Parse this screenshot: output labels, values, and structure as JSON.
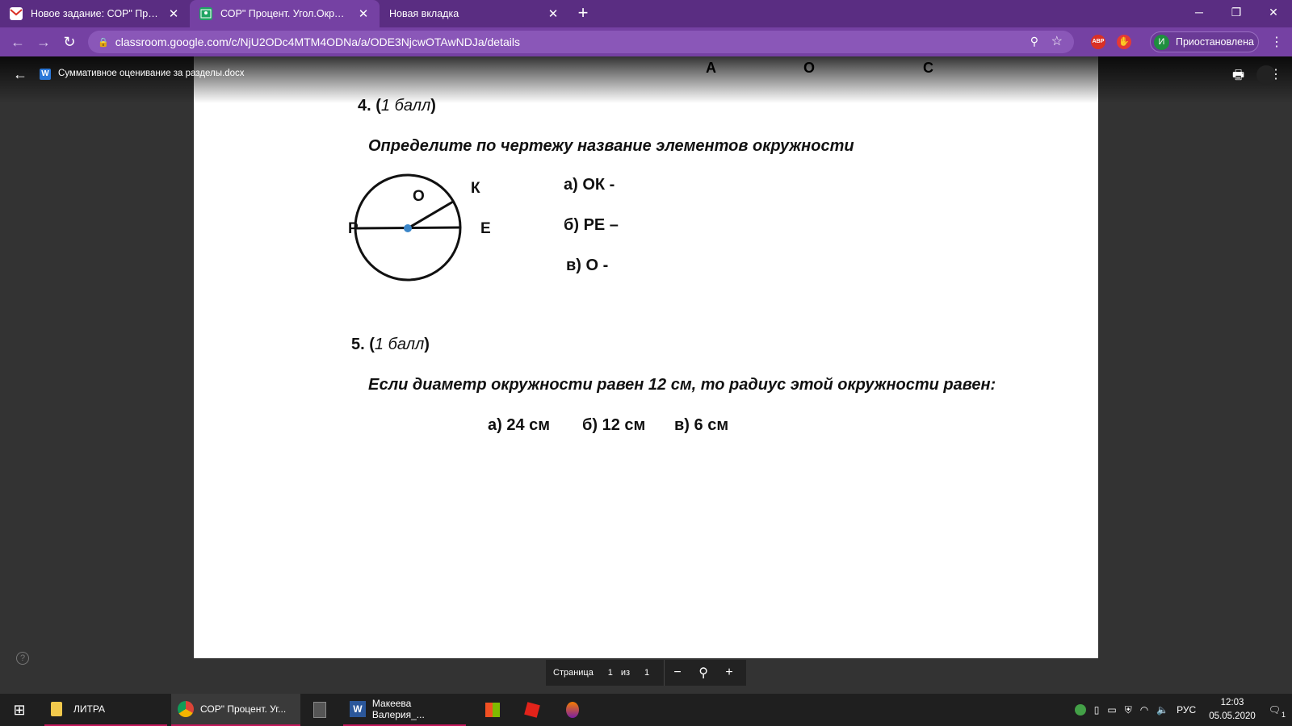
{
  "browser": {
    "tabs": [
      {
        "title": "Новое задание: СОР\" Процент.",
        "favicon": "gmail-icon",
        "active": false
      },
      {
        "title": "СОР\" Процент. Угол.Окружност",
        "favicon": "classroom-icon",
        "active": true
      },
      {
        "title": "Новая вкладка",
        "favicon": "",
        "active": false
      }
    ],
    "url": "classroom.google.com/c/NjU2ODc4MTM4ODNa/a/ODE3NjcwOTAwNDJa/details",
    "profile_initial": "И",
    "profile_label": "Приостановлена",
    "ext_abp": "ABP"
  },
  "viewer": {
    "doc_name": "Суммативное оценивание за разделы.docx",
    "page_label": "Страница",
    "page_current": "1",
    "page_of": "из",
    "page_total": "1"
  },
  "document": {
    "header_letters": [
      "А",
      "О",
      "С"
    ],
    "task4": {
      "number": "4. (",
      "points": "1 балл",
      "close": ")"
    },
    "task4_question": "Определите по чертежу название элементов окружности",
    "circle_labels": {
      "center": "О",
      "k": "К",
      "p": "Р",
      "e": "Е"
    },
    "task4_answers": [
      "а) ОК -",
      "б) РЕ –",
      "в) О -"
    ],
    "task5": {
      "number": "5. (",
      "points": "1 балл",
      "close": ")"
    },
    "task5_question": "Если диаметр окружности равен 12 см, то радиус этой окружности равен:",
    "task5_options": [
      "а) 24 см",
      "б) 12 см",
      "в) 6 см"
    ]
  },
  "taskbar": {
    "items": [
      {
        "label": "ЛИТРА"
      },
      {
        "label": "СОР\" Процент. Уг..."
      },
      {
        "label": "Макеева Валерия_..."
      }
    ],
    "lang": "РУС",
    "time": "12:03",
    "date": "05.05.2020",
    "notif_count": "1"
  }
}
